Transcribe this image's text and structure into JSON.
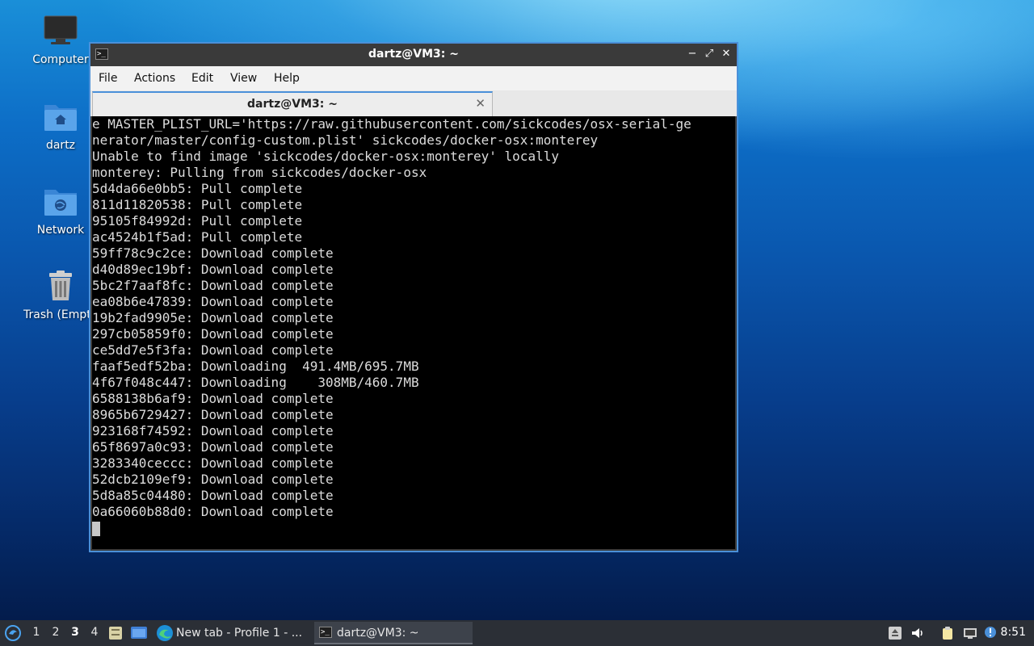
{
  "desktop": {
    "icons": [
      {
        "label": "Computer",
        "icon": "monitor-icon"
      },
      {
        "label": "dartz",
        "icon": "home-folder-icon"
      },
      {
        "label": "Network",
        "icon": "network-folder-icon"
      },
      {
        "label": "Trash (Empty)",
        "icon": "trash-icon"
      }
    ]
  },
  "window": {
    "title": "dartz@VM3: ~",
    "buttons": {
      "minimize": "−",
      "maximize": "⤢",
      "close": "✕"
    },
    "menu": [
      "File",
      "Actions",
      "Edit",
      "View",
      "Help"
    ],
    "tab": {
      "label": "dartz@VM3: ~",
      "close": "✕"
    }
  },
  "terminal": {
    "lines": [
      "e MASTER_PLIST_URL='https://raw.githubusercontent.com/sickcodes/osx-serial-ge",
      "nerator/master/config-custom.plist' sickcodes/docker-osx:monterey",
      "Unable to find image 'sickcodes/docker-osx:monterey' locally",
      "monterey: Pulling from sickcodes/docker-osx",
      "5d4da66e0bb5: Pull complete",
      "811d11820538: Pull complete",
      "95105f84992d: Pull complete",
      "ac4524b1f5ad: Pull complete",
      "59ff78c9c2ce: Download complete",
      "d40d89ec19bf: Download complete",
      "5bc2f7aaf8fc: Download complete",
      "ea08b6e47839: Download complete",
      "19b2fad9905e: Download complete",
      "297cb05859f0: Download complete",
      "ce5dd7e5f3fa: Download complete",
      "faaf5edf52ba: Downloading  491.4MB/695.7MB",
      "4f67f048c447: Downloading    308MB/460.7MB",
      "6588138b6af9: Download complete",
      "8965b6729427: Download complete",
      "923168f74592: Download complete",
      "65f8697a0c93: Download complete",
      "3283340ceccc: Download complete",
      "52dcb2109ef9: Download complete",
      "5d8a85c04480: Download complete",
      "0a66060b88d0: Download complete"
    ]
  },
  "taskbar": {
    "workspaces": [
      "1",
      "2",
      "3",
      "4"
    ],
    "active_workspace": "3",
    "tasks": [
      {
        "label": "New tab - Profile 1 - ...",
        "icon": "edge-browser-icon"
      },
      {
        "label": "dartz@VM3: ~",
        "icon": "terminal-icon"
      }
    ],
    "clock": "8:51"
  },
  "colors": {
    "accent": "#4a90d9",
    "terminal_bg": "#000000",
    "terminal_fg": "#dcdcdc",
    "taskbar_bg": "#2b2f36"
  }
}
